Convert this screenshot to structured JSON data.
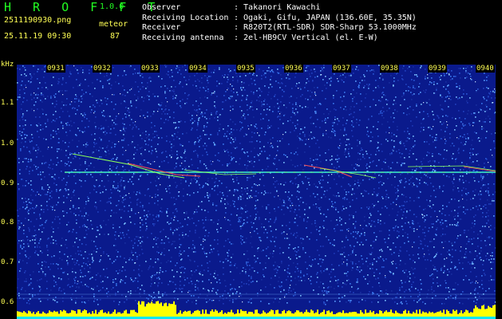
{
  "header": {
    "brand": "H R O F F T",
    "version": "1.0.0",
    "filename": "2511190930.png",
    "datetime": "25.11.19 09:30",
    "meteor_label": "meteor",
    "meteor_count": "87",
    "info": [
      {
        "key": "Observer",
        "value": ": Takanori Kawachi"
      },
      {
        "key": "Receiving Location",
        "value": ": Ogaki, Gifu, JAPAN (136.60E, 35.35N)"
      },
      {
        "key": "Receiver",
        "value": ": R820T2(RTL-SDR) SDR-Sharp 53.1000MHz"
      },
      {
        "key": "Receiving antenna",
        "value": ": 2el-HB9CV Vertical (el. E-W)"
      }
    ]
  },
  "spectrogram": {
    "unit": "kHz",
    "y_ticks": [
      "1.1",
      "1.0",
      "0.9",
      "0.8",
      "0.7",
      "0.6"
    ],
    "x_ticks": [
      "0931",
      "0932",
      "0933",
      "0934",
      "0935",
      "0936",
      "0937",
      "0938",
      "0939",
      "0940"
    ],
    "colors": {
      "background": "#0a1a8c",
      "noise_light": "#3aa0ff",
      "trace_cyan": "#3af0d0",
      "trace_green": "#8aff5a",
      "trace_red": "#ff5050",
      "noise_yellow": "#ffff00"
    }
  }
}
